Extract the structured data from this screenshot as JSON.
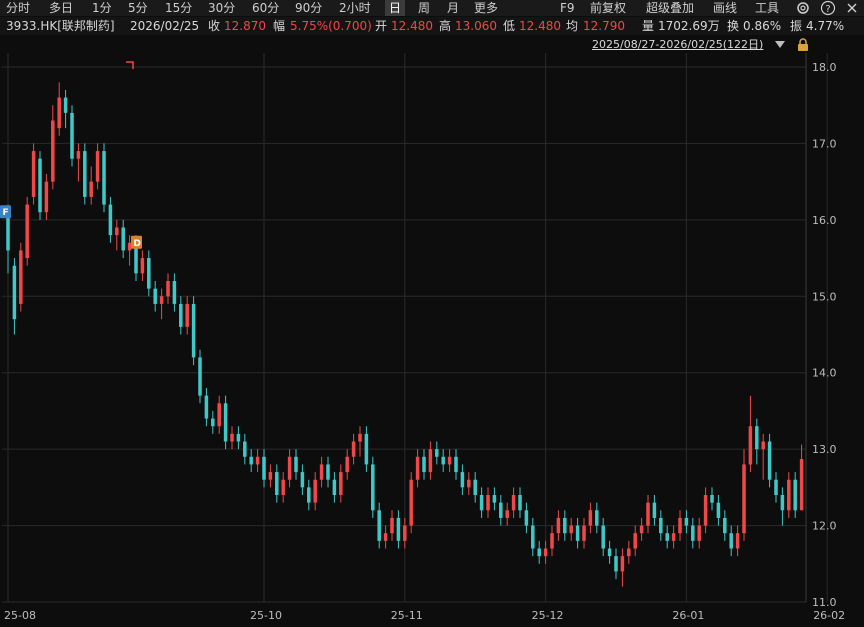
{
  "toolbar": {
    "periods": [
      "分时",
      "多日",
      "1分",
      "5分",
      "15分",
      "30分",
      "60分",
      "90分",
      "2小时",
      "日",
      "周",
      "月",
      "更多"
    ],
    "active_period": "日",
    "right": [
      "F9",
      "前复权",
      "超级叠加",
      "画线",
      "工具"
    ]
  },
  "quote": {
    "symbol": "3933.HK[联邦制药]",
    "date": "2026/02/25",
    "close_label": "收",
    "close": "12.870",
    "change_label": "幅",
    "change": "5.75%(0.700)",
    "open_label": "开",
    "open": "12.480",
    "high_label": "高",
    "high": "13.060",
    "low_label": "低",
    "low": "12.480",
    "avg_label": "均",
    "avg": "12.790",
    "volume_label": "量",
    "volume": "1702.69万",
    "turnover_label": "换",
    "turnover": "0.86%",
    "amplitude_label": "振",
    "amplitude": "4.77%"
  },
  "range_text": "2025/08/27-2026/02/25(122日)",
  "colors": {
    "up": "#f04848",
    "down": "#3ec9c9",
    "grid": "#2a2a2a",
    "bg": "#0d0d0d",
    "marker_f": "#3b82c4",
    "marker_d": "#d9822b"
  },
  "chart_data": {
    "type": "candlestick",
    "ylim": [
      11.0,
      18.0
    ],
    "y_ticks": [
      "11.0",
      "12.0",
      "13.0",
      "14.0",
      "15.0",
      "16.0",
      "17.0",
      "18.0"
    ],
    "x_tick_labels": [
      "25-08",
      "25-10",
      "25-11",
      "25-12",
      "26-01",
      "26-02"
    ],
    "x_tick_index": [
      0,
      40,
      62,
      84,
      106,
      128
    ],
    "markers": [
      {
        "text": "F",
        "index": 0,
        "value": 16.1
      },
      {
        "text": "D",
        "index": 20,
        "value": 15.7
      }
    ],
    "candles": [
      [
        16.1,
        15.6,
        16.2,
        15.3
      ],
      [
        15.4,
        14.7,
        15.5,
        14.5
      ],
      [
        14.9,
        15.6,
        15.7,
        14.8
      ],
      [
        15.5,
        16.2,
        16.3,
        15.4
      ],
      [
        16.3,
        16.9,
        17.0,
        16.2
      ],
      [
        16.8,
        16.1,
        16.9,
        16.0
      ],
      [
        16.1,
        16.5,
        16.6,
        16.0
      ],
      [
        16.5,
        17.3,
        17.5,
        16.4
      ],
      [
        17.2,
        17.6,
        17.8,
        17.1
      ],
      [
        17.6,
        17.4,
        17.7,
        17.2
      ],
      [
        17.4,
        16.8,
        17.5,
        16.7
      ],
      [
        16.8,
        16.9,
        17.0,
        16.5
      ],
      [
        16.9,
        16.3,
        17.0,
        16.2
      ],
      [
        16.3,
        16.5,
        16.7,
        16.2
      ],
      [
        16.5,
        16.9,
        17.0,
        16.4
      ],
      [
        16.9,
        16.2,
        17.0,
        16.1
      ],
      [
        16.2,
        15.8,
        16.3,
        15.7
      ],
      [
        15.8,
        15.9,
        16.0,
        15.6
      ],
      [
        15.9,
        15.6,
        16.0,
        15.5
      ],
      [
        15.6,
        15.7,
        15.8,
        15.4
      ],
      [
        15.7,
        15.3,
        15.8,
        15.2
      ],
      [
        15.3,
        15.5,
        15.6,
        15.2
      ],
      [
        15.5,
        15.1,
        15.6,
        15.0
      ],
      [
        15.1,
        14.9,
        15.2,
        14.8
      ],
      [
        14.9,
        15.0,
        15.1,
        14.7
      ],
      [
        15.0,
        15.2,
        15.3,
        14.9
      ],
      [
        15.2,
        14.9,
        15.3,
        14.8
      ],
      [
        14.9,
        14.6,
        15.0,
        14.5
      ],
      [
        14.6,
        14.9,
        15.0,
        14.5
      ],
      [
        14.9,
        14.2,
        15.0,
        14.1
      ],
      [
        14.2,
        13.7,
        14.3,
        13.6
      ],
      [
        13.7,
        13.4,
        13.8,
        13.3
      ],
      [
        13.4,
        13.3,
        13.5,
        13.2
      ],
      [
        13.3,
        13.6,
        13.7,
        13.2
      ],
      [
        13.6,
        13.1,
        13.7,
        13.0
      ],
      [
        13.1,
        13.2,
        13.3,
        13.0
      ],
      [
        13.2,
        13.1,
        13.3,
        13.0
      ],
      [
        13.1,
        12.9,
        13.2,
        12.8
      ],
      [
        12.9,
        12.8,
        13.0,
        12.7
      ],
      [
        12.8,
        12.9,
        13.0,
        12.7
      ],
      [
        12.9,
        12.6,
        13.0,
        12.5
      ],
      [
        12.6,
        12.7,
        12.8,
        12.5
      ],
      [
        12.7,
        12.4,
        12.8,
        12.3
      ],
      [
        12.4,
        12.6,
        12.7,
        12.3
      ],
      [
        12.6,
        12.9,
        13.0,
        12.5
      ],
      [
        12.9,
        12.7,
        13.0,
        12.6
      ],
      [
        12.7,
        12.5,
        12.8,
        12.4
      ],
      [
        12.5,
        12.3,
        12.6,
        12.2
      ],
      [
        12.3,
        12.6,
        12.7,
        12.2
      ],
      [
        12.6,
        12.8,
        12.9,
        12.5
      ],
      [
        12.8,
        12.6,
        12.9,
        12.5
      ],
      [
        12.6,
        12.4,
        12.7,
        12.3
      ],
      [
        12.4,
        12.7,
        12.8,
        12.3
      ],
      [
        12.7,
        12.9,
        13.0,
        12.6
      ],
      [
        12.9,
        13.1,
        13.2,
        12.8
      ],
      [
        13.1,
        13.2,
        13.3,
        12.9
      ],
      [
        13.2,
        12.8,
        13.3,
        12.7
      ],
      [
        12.8,
        12.2,
        12.9,
        12.1
      ],
      [
        12.2,
        11.8,
        12.3,
        11.7
      ],
      [
        11.8,
        11.9,
        12.0,
        11.7
      ],
      [
        11.9,
        12.1,
        12.2,
        11.8
      ],
      [
        12.1,
        11.8,
        12.2,
        11.7
      ],
      [
        11.8,
        12.0,
        12.1,
        11.7
      ],
      [
        12.0,
        12.6,
        12.7,
        11.9
      ],
      [
        12.6,
        12.9,
        13.0,
        12.5
      ],
      [
        12.9,
        12.7,
        13.0,
        12.6
      ],
      [
        12.7,
        13.0,
        13.1,
        12.6
      ],
      [
        13.0,
        12.9,
        13.1,
        12.8
      ],
      [
        12.9,
        12.8,
        13.0,
        12.7
      ],
      [
        12.8,
        12.9,
        13.0,
        12.7
      ],
      [
        12.9,
        12.7,
        13.0,
        12.6
      ],
      [
        12.7,
        12.5,
        12.8,
        12.4
      ],
      [
        12.5,
        12.6,
        12.7,
        12.4
      ],
      [
        12.6,
        12.4,
        12.7,
        12.3
      ],
      [
        12.4,
        12.2,
        12.5,
        12.1
      ],
      [
        12.2,
        12.4,
        12.5,
        12.1
      ],
      [
        12.4,
        12.3,
        12.5,
        12.2
      ],
      [
        12.3,
        12.1,
        12.4,
        12.0
      ],
      [
        12.1,
        12.2,
        12.3,
        12.0
      ],
      [
        12.2,
        12.4,
        12.5,
        12.1
      ],
      [
        12.4,
        12.2,
        12.5,
        12.1
      ],
      [
        12.2,
        12.0,
        12.3,
        11.9
      ],
      [
        12.0,
        11.7,
        12.1,
        11.6
      ],
      [
        11.7,
        11.6,
        11.8,
        11.5
      ],
      [
        11.6,
        11.7,
        11.8,
        11.5
      ],
      [
        11.7,
        11.9,
        12.0,
        11.6
      ],
      [
        11.9,
        12.1,
        12.2,
        11.8
      ],
      [
        12.1,
        11.9,
        12.2,
        11.8
      ],
      [
        11.9,
        12.0,
        12.1,
        11.8
      ],
      [
        12.0,
        11.8,
        12.1,
        11.7
      ],
      [
        11.8,
        12.0,
        12.1,
        11.7
      ],
      [
        12.0,
        12.2,
        12.3,
        11.9
      ],
      [
        12.2,
        12.0,
        12.3,
        11.9
      ],
      [
        12.0,
        11.7,
        12.1,
        11.6
      ],
      [
        11.7,
        11.6,
        11.8,
        11.5
      ],
      [
        11.6,
        11.4,
        11.7,
        11.3
      ],
      [
        11.4,
        11.6,
        11.7,
        11.2
      ],
      [
        11.6,
        11.7,
        11.8,
        11.5
      ],
      [
        11.7,
        11.9,
        12.0,
        11.6
      ],
      [
        11.9,
        12.0,
        12.1,
        11.8
      ],
      [
        12.0,
        12.3,
        12.4,
        11.9
      ],
      [
        12.3,
        12.1,
        12.4,
        12.0
      ],
      [
        12.1,
        11.9,
        12.2,
        11.8
      ],
      [
        11.9,
        11.8,
        12.0,
        11.7
      ],
      [
        11.8,
        11.9,
        12.0,
        11.7
      ],
      [
        11.9,
        12.1,
        12.2,
        11.8
      ],
      [
        12.1,
        12.0,
        12.2,
        11.9
      ],
      [
        12.0,
        11.8,
        12.1,
        11.7
      ],
      [
        11.8,
        12.0,
        12.1,
        11.7
      ],
      [
        12.0,
        12.4,
        12.5,
        11.9
      ],
      [
        12.4,
        12.3,
        12.5,
        12.2
      ],
      [
        12.3,
        12.1,
        12.4,
        12.0
      ],
      [
        12.1,
        11.9,
        12.2,
        11.8
      ],
      [
        11.9,
        11.7,
        12.0,
        11.6
      ],
      [
        11.7,
        11.9,
        12.0,
        11.6
      ],
      [
        11.9,
        12.8,
        13.0,
        11.8
      ],
      [
        12.8,
        13.3,
        13.7,
        12.7
      ],
      [
        13.3,
        13.0,
        13.4,
        12.8
      ],
      [
        13.0,
        13.1,
        13.2,
        12.6
      ],
      [
        13.1,
        12.6,
        13.2,
        12.5
      ],
      [
        12.6,
        12.4,
        12.7,
        12.3
      ],
      [
        12.4,
        12.2,
        12.5,
        12.0
      ],
      [
        12.2,
        12.6,
        12.7,
        12.1
      ],
      [
        12.6,
        12.2,
        12.7,
        12.1
      ],
      [
        12.2,
        12.87,
        13.06,
        12.48
      ]
    ]
  }
}
